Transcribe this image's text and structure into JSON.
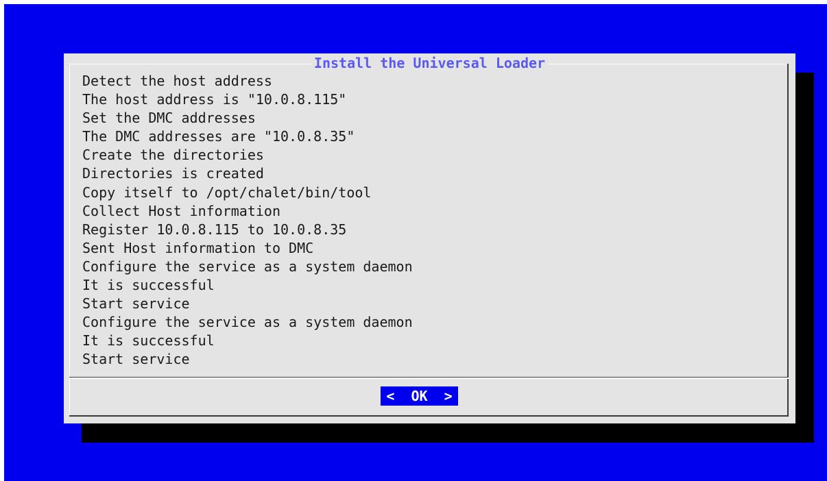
{
  "dialog": {
    "title": "Install the Universal Loader",
    "lines": [
      "Detect the host address",
      "The host address is \"10.0.8.115\"",
      "Set the DMC addresses",
      "The DMC addresses are \"10.0.8.35\"",
      "Create the directories",
      "Directories is created",
      "Copy itself to /opt/chalet/bin/tool",
      "Collect Host information",
      "Register 10.0.8.115 to 10.0.8.35",
      "Sent Host information to DMC",
      "Configure the service as a system daemon",
      "It is successful",
      "Start service",
      "Configure the service as a system daemon",
      "It is successful",
      "Start service"
    ],
    "ok_button_label": "<  OK  >"
  },
  "colors": {
    "background": "#0000ee",
    "dialog": "#e4e4e4",
    "shadow": "#000000",
    "title": "#5a5aef",
    "button_bg": "#0000ee",
    "button_text": "#ffffff"
  }
}
